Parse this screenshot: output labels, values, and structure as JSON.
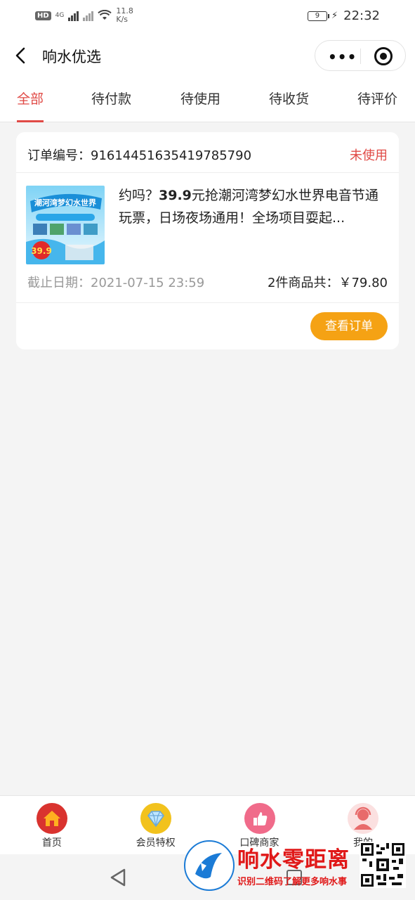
{
  "status_bar": {
    "hd_badge": "HD",
    "network": "4G",
    "speed_value": "11.8",
    "speed_unit": "K/s",
    "battery": "9",
    "time": "22:32"
  },
  "nav": {
    "title": "响水优选",
    "capsule_more": "•••"
  },
  "tabs": [
    {
      "label": "全部",
      "active": true
    },
    {
      "label": "待付款",
      "active": false
    },
    {
      "label": "待使用",
      "active": false
    },
    {
      "label": "待收货",
      "active": false
    },
    {
      "label": "待评价",
      "active": false
    }
  ],
  "order": {
    "number_label": "订单编号：",
    "number": "9161445163541978579 0",
    "status": "未使用",
    "title_prefix": "约吗？",
    "title_bold": "39.9",
    "title_rest": "元抢潮河湾梦幻水世界电音节通玩票，日场夜场通用！全场项目耍起...",
    "deadline_label": "截止日期：",
    "deadline": "2021-07-15 23:59",
    "total_label": "2件商品共：",
    "total": "￥79.80",
    "button": "查看订单",
    "thumb_text": "潮河湾梦幻水世界",
    "thumb_price": "39.9"
  },
  "bottom_nav": [
    {
      "label": "首页",
      "icon": "home-icon",
      "color": "#d9332f"
    },
    {
      "label": "会员特权",
      "icon": "diamond-icon",
      "color": "#f2c21d"
    },
    {
      "label": "口碑商家",
      "icon": "thumbs-up-icon",
      "color": "#f06b8a"
    },
    {
      "label": "我的",
      "icon": "profile-icon",
      "color": "#e86b6b"
    }
  ],
  "watermark": {
    "name": "响水零距离",
    "sub": "识别二维码了解更多响水事"
  },
  "colors": {
    "accent": "#e04a46",
    "button": "#f5a214"
  }
}
